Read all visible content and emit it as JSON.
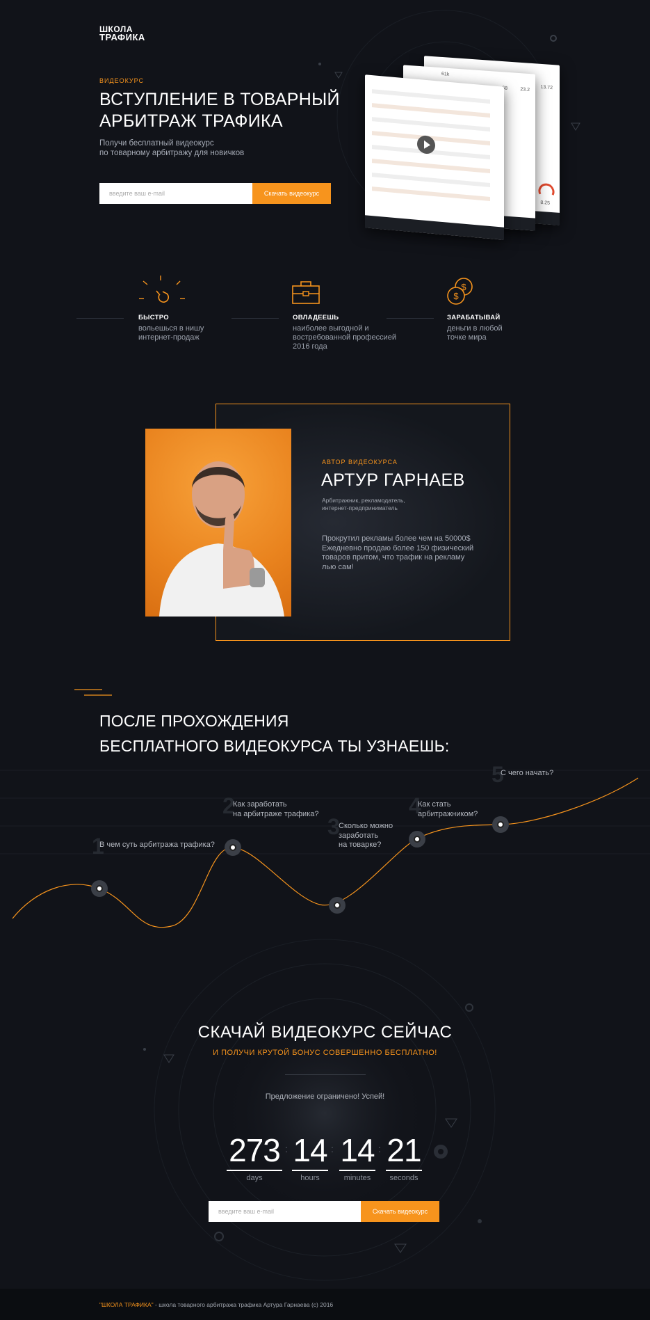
{
  "header": {
    "logo_line1": "ШКОЛА",
    "logo_line2": "ТРАФИКА"
  },
  "hero": {
    "tag": "ВИДЕОКУРС",
    "title": "ВСТУПЛЕНИЕ В ТОВАРНЫЙ АРБИТРАЖ ТРАФИКА",
    "subtitle_line1": "Получи бесплатный видеокурс",
    "subtitle_line2": "по товарному арбитражу для новичков",
    "email_placeholder": "введите ваш e-mail",
    "button": "Скачать видеокурс",
    "screen_values": [
      "61k",
      "68",
      "23.2",
      "13.72",
      "8.25"
    ]
  },
  "features": [
    {
      "icon": "meteor-icon",
      "title": "БЫСТРО",
      "text": "вольешься в нишу интернет-продаж"
    },
    {
      "icon": "briefcase-icon",
      "title": "ОВЛАДЕЕШЬ",
      "text": "наиболее выгодной и востребованной профессией 2016 года"
    },
    {
      "icon": "coins-icon",
      "title": "ЗАРАБАТЫВАЙ",
      "text": "деньги в любой точке мира"
    }
  ],
  "author": {
    "tag": "АВТОР ВИДЕОКУРСА",
    "name": "АРТУР ГАРНАЕВ",
    "role_line1": "Арбитражник, рекламодатель,",
    "role_line2": "интернет-предприниматель",
    "bio": "Прокрутил рекламы более чем на 50000$ Ежедневно продаю более 150 физический товаров притом, что трафик на рекламу лью сам!"
  },
  "learn": {
    "title_line1": "ПОСЛЕ ПРОХОЖДЕНИЯ",
    "title_line2": "БЕСПЛАТНОГО ВИДЕОКУРСА ТЫ УЗНАЕШЬ:",
    "points": [
      {
        "num": "1",
        "line1": "В чем суть арбитража трафика?",
        "line2": "",
        "line3": ""
      },
      {
        "num": "2",
        "line1": "Как заработать",
        "line2": "на арбитраже трафика?",
        "line3": ""
      },
      {
        "num": "3",
        "line1": "Сколько можно",
        "line2": "заработать",
        "line3": "на товарке?"
      },
      {
        "num": "4",
        "line1": "Как стать",
        "line2": "арбитражником?",
        "line3": ""
      },
      {
        "num": "5",
        "line1": "С чего начать?",
        "line2": "",
        "line3": ""
      }
    ]
  },
  "countdown": {
    "title": "СКАЧАЙ ВИДЕОКУРС СЕЙЧАС",
    "subtitle": "И ПОЛУЧИ КРУТОЙ БОНУС СОВЕРШЕННО БЕСПЛАТНО!",
    "offer": "Предложение ограничено! Успей!",
    "units": [
      {
        "value": "273",
        "label": "days"
      },
      {
        "value": "14",
        "label": "hours"
      },
      {
        "value": "14",
        "label": "minutes"
      },
      {
        "value": "21",
        "label": "seconds"
      }
    ],
    "email_placeholder": "введите ваш e-mail",
    "button": "Скачать видеокурс"
  },
  "footer": {
    "brand": "\"ШКОЛА ТРАФИКА\"",
    "text": " - школа товарного арбитража трафика Артура Гарнаева (с) 2016"
  },
  "colors": {
    "accent": "#f7941d",
    "background": "#111319"
  }
}
